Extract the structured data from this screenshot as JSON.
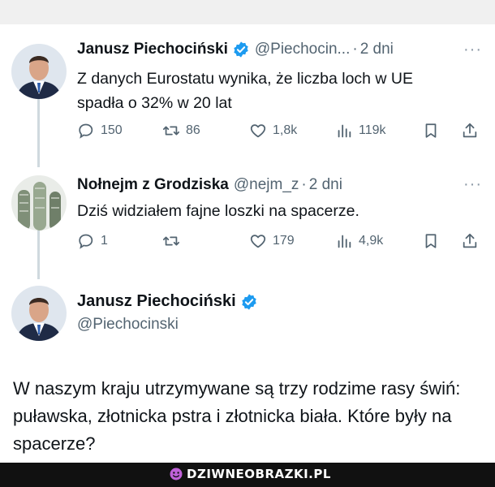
{
  "tweet1": {
    "name": "Janusz Piechociński",
    "handle": "@Piechocin...",
    "separator": "·",
    "time": "2 dni",
    "more": "···",
    "text": "Z danych Eurostatu wynika, że liczba loch w UE spadła o 32% w 20 lat",
    "replies": "150",
    "retweets": "86",
    "likes": "1,8k",
    "views": "119k"
  },
  "tweet2": {
    "name": "Nołnejm z Grodziska",
    "handle": "@nejm_z",
    "separator": "·",
    "time": "2 dni",
    "more": "···",
    "text": "Dziś widziałem fajne loszki na spacerze.",
    "replies": "1",
    "retweets": "",
    "likes": "179",
    "views": "4,9k"
  },
  "tweet3": {
    "name": "Janusz Piechociński",
    "handle": "@Piechocinski",
    "text": "W naszym kraju utrzymywane są trzy rodzime rasy świń: puławska, złotnicka pstra i złotnicka biała. Które były na spacerze?"
  },
  "footer": {
    "brand": "DZIWNEOBRAZKI.PL"
  },
  "colors": {
    "verified": "#1d9bf0",
    "muted": "#536471",
    "thread_line": "#cfd9de",
    "text": "#0f1419",
    "footer_bg": "#111111"
  },
  "icons": [
    "reply-icon",
    "retweet-icon",
    "like-icon",
    "views-icon",
    "bookmark-icon",
    "share-icon",
    "verified-badge-icon",
    "more-icon"
  ]
}
